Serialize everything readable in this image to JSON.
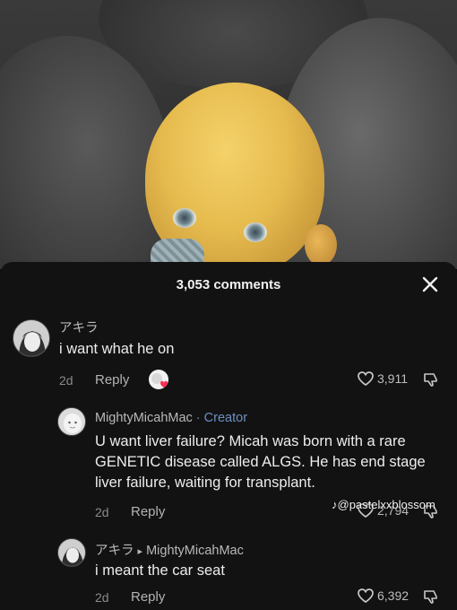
{
  "header": {
    "comment_count": "3,053 comments"
  },
  "comments": [
    {
      "username": "アキラ",
      "text": "i want what he on",
      "time": "2d",
      "reply_label": "Reply",
      "likes": "3,911"
    },
    {
      "username": "MightyMicahMac",
      "creator_label": " · Creator",
      "text": "U want liver failure? Micah was born with a rare GENETIC disease called ALGS. He has end stage liver failure, waiting for transplant.",
      "time": "2d",
      "reply_label": "Reply",
      "likes": "2,794"
    },
    {
      "username": "アキラ",
      "reply_arrow": "▸",
      "reply_to": "MightyMicahMac",
      "text": "i meant the car seat",
      "time": "2d",
      "reply_label": "Reply",
      "likes": "6,392"
    }
  ],
  "watermark": {
    "text": "@pastelxxblossom",
    "icon": "tiktok-icon"
  },
  "icons": {
    "close": "close-icon",
    "like": "heart-outline-icon",
    "dislike": "thumbs-down-icon",
    "reaction": "creator-liked-icon"
  },
  "colors": {
    "background": "#121212",
    "creator_accent": "#6d8fc4",
    "text_primary": "#ededed",
    "text_muted": "#8a8a8a"
  }
}
